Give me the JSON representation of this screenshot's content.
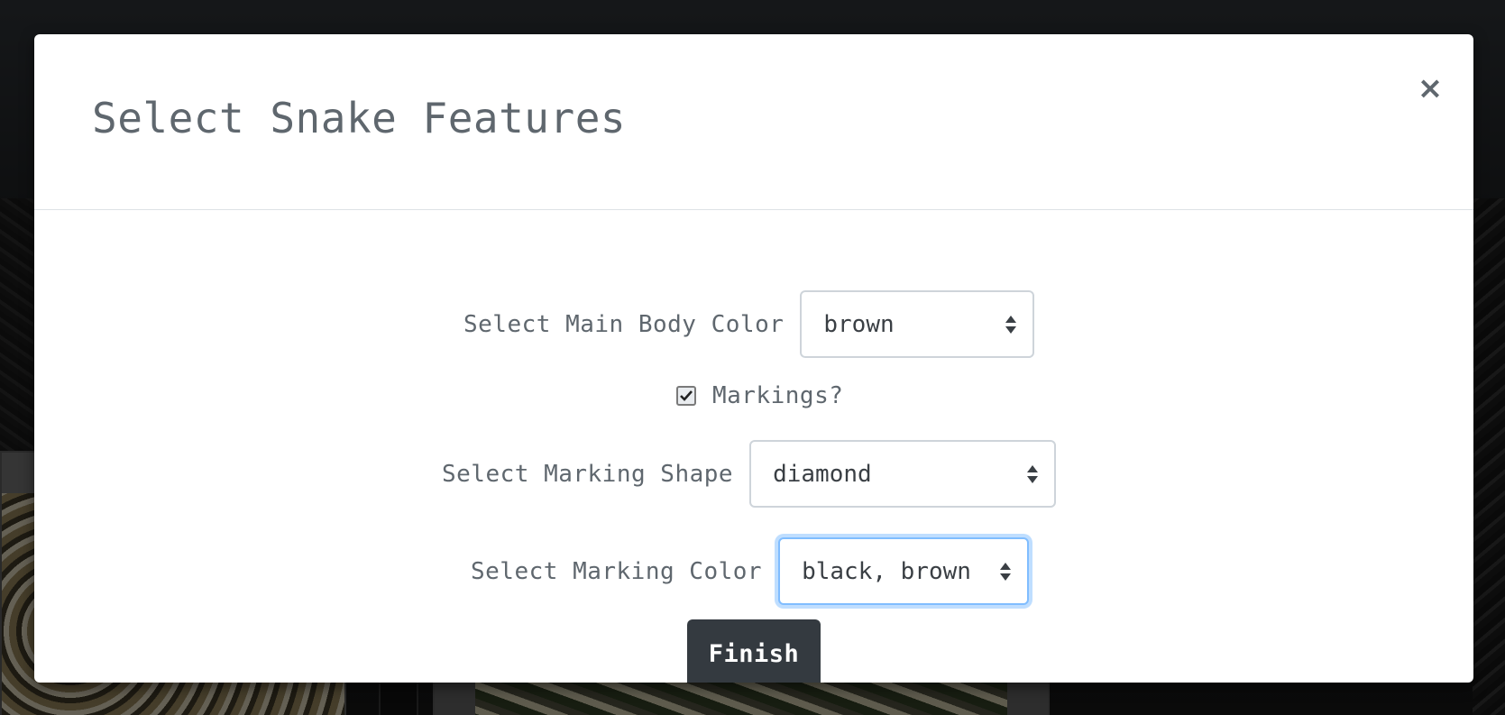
{
  "modal": {
    "title": "Select Snake Features",
    "close_label": "×"
  },
  "form": {
    "main_body_color": {
      "label": "Select Main Body Color",
      "value": "brown"
    },
    "markings": {
      "label": "Markings?",
      "checked": true
    },
    "marking_shape": {
      "label": "Select Marking Shape",
      "value": "diamond"
    },
    "marking_color": {
      "label": "Select Marking Color",
      "value": "black, brown"
    },
    "finish_label": "Finish"
  },
  "colors": {
    "modal_bg": "#ffffff",
    "text_muted": "#5f676e",
    "button_dark": "#343a40",
    "focus_border": "#80bdff"
  },
  "icons": {
    "close": "close-icon",
    "select_arrows": "sort-arrows-icon",
    "checkbox_check": "check-icon"
  }
}
